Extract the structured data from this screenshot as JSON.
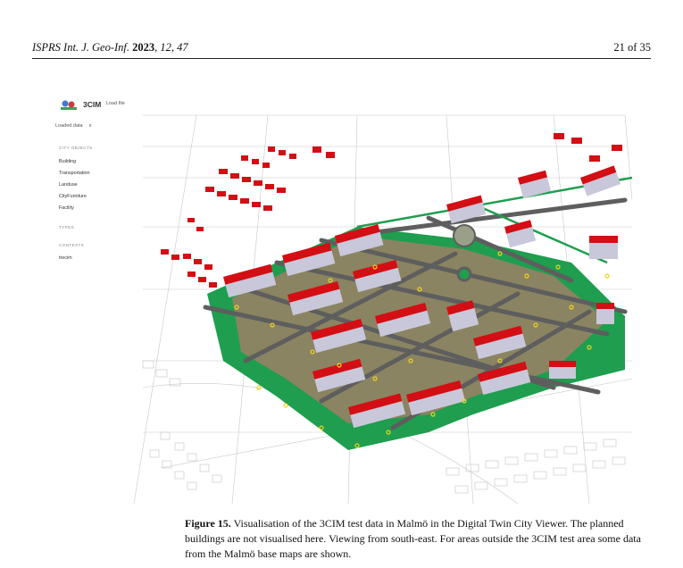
{
  "header": {
    "journal": "ISPRS Int. J. Geo-Inf.",
    "year": "2023",
    "volume_issue": ", 12, 47",
    "page": "21 of 35"
  },
  "app": {
    "name": "3CIM",
    "load_file": "Load file",
    "loaded_data_label": "Loaded data",
    "close_glyph": "x",
    "sections": {
      "city_objects": "CITY OBJECTS",
      "types": "TYPES",
      "contexts": "CONTEXTS"
    },
    "city_objects": [
      "Building",
      "Transportation",
      "Landuse",
      "CityFurniture",
      "Facility"
    ],
    "contexts": [
      "trecim"
    ]
  },
  "colors": {
    "roof": "#d30e14",
    "wall": "#c9c7da",
    "grass": "#1e9e4e",
    "road": "#6a6a6a",
    "plaza": "#8a8462",
    "furniture": "#f2d21b"
  },
  "caption": {
    "label": "Figure 15.",
    "text": " Visualisation of the 3CIM test data in Malmö in the Digital Twin City Viewer. The planned buildings are not visualised here. Viewing from south-east. For areas outside the 3CIM test area some data from the Malmö base maps are shown."
  }
}
